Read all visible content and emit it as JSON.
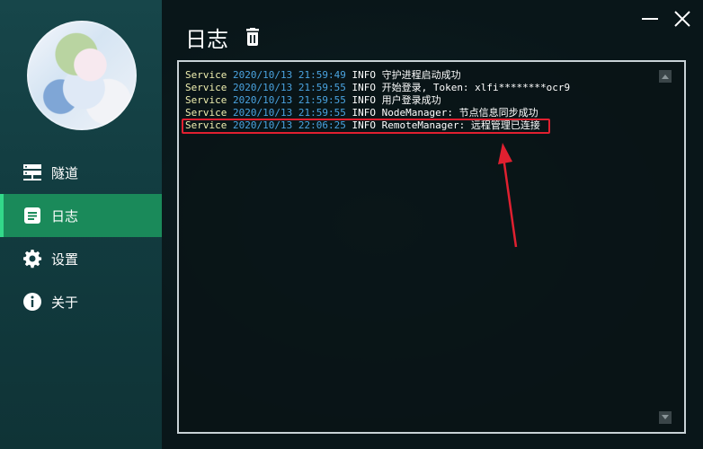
{
  "sidebar": {
    "items": [
      {
        "label": "隧道",
        "icon": "server-icon",
        "active": false
      },
      {
        "label": "日志",
        "icon": "document-icon",
        "active": true
      },
      {
        "label": "设置",
        "icon": "gear-icon",
        "active": false
      },
      {
        "label": "关于",
        "icon": "info-icon",
        "active": false
      }
    ]
  },
  "header": {
    "title": "日志"
  },
  "log": {
    "lines": [
      {
        "source": "Service",
        "timestamp": "2020/10/13 21:59:49",
        "level": "INFO",
        "message": "守护进程启动成功"
      },
      {
        "source": "Service",
        "timestamp": "2020/10/13 21:59:55",
        "level": "INFO",
        "message": "开始登录, Token: xlfi********ocr9"
      },
      {
        "source": "Service",
        "timestamp": "2020/10/13 21:59:55",
        "level": "INFO",
        "message": "用户登录成功"
      },
      {
        "source": "Service",
        "timestamp": "2020/10/13 21:59:55",
        "level": "INFO",
        "message": "NodeManager: 节点信息同步成功"
      },
      {
        "source": "Service",
        "timestamp": "2020/10/13 22:06:25",
        "level": "INFO",
        "message": "RemoteManager: 远程管理已连接"
      }
    ]
  },
  "colors": {
    "accent": "#1a8a5a",
    "sidebar_bg": "#134045",
    "timestamp": "#4aa3e0",
    "annotation": "#e02030"
  }
}
